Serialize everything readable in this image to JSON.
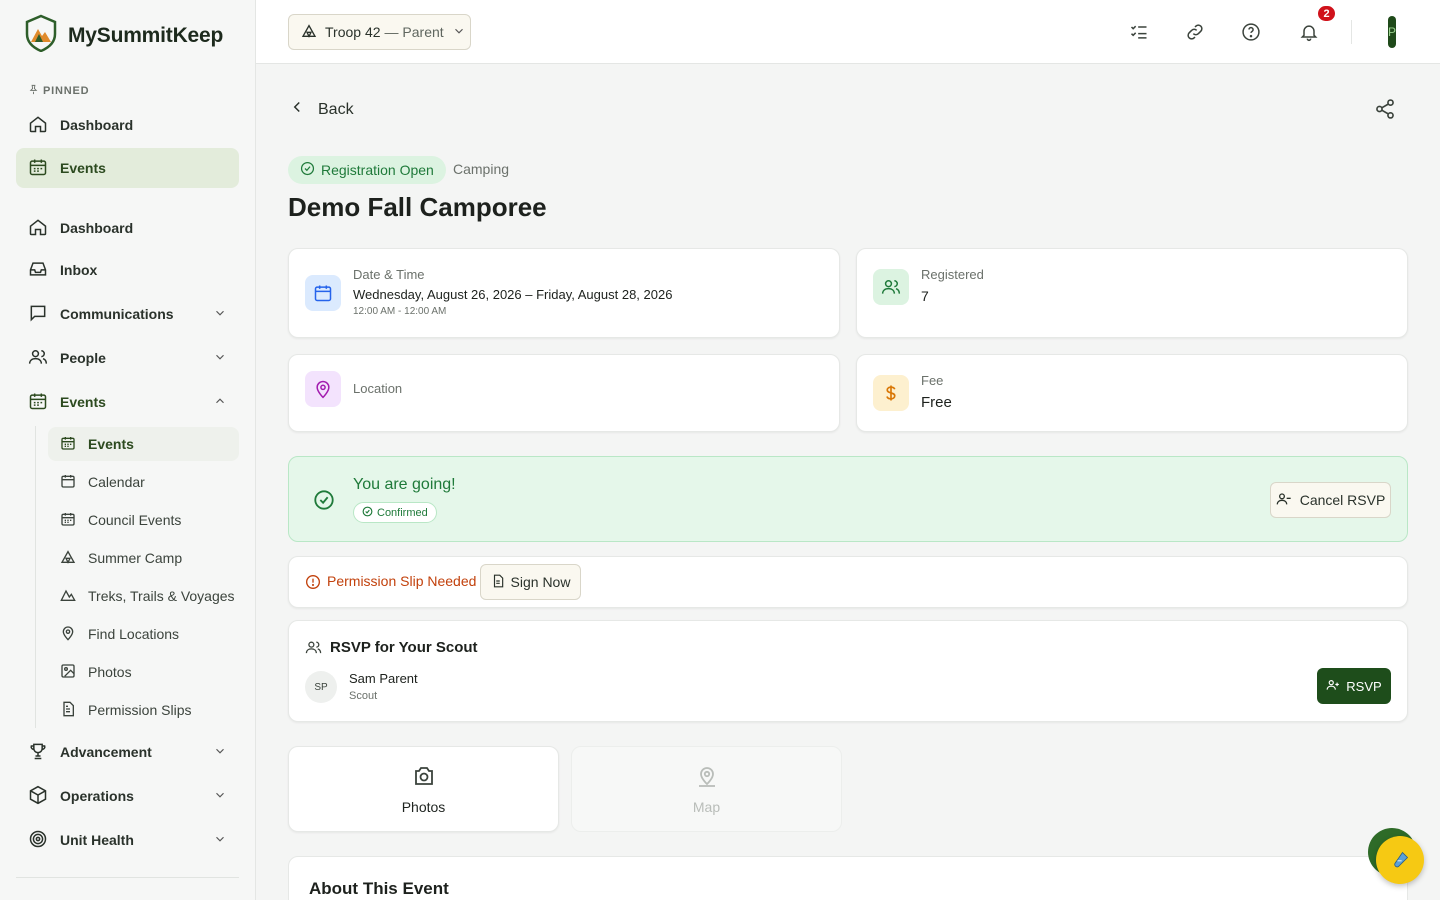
{
  "brand": {
    "name": "MySummitKeep"
  },
  "sidebar": {
    "pinned_label": "PINNED",
    "pinned": [
      {
        "label": "Dashboard",
        "icon": "home-icon"
      },
      {
        "label": "Events",
        "icon": "calendar-icon"
      }
    ],
    "items": [
      {
        "label": "Dashboard",
        "icon": "home-icon"
      },
      {
        "label": "Inbox",
        "icon": "inbox-icon"
      },
      {
        "label": "Communications",
        "icon": "message-icon"
      },
      {
        "label": "People",
        "icon": "people-icon"
      },
      {
        "label": "Events",
        "icon": "calendar-icon"
      },
      {
        "label": "Advancement",
        "icon": "trophy-icon"
      },
      {
        "label": "Operations",
        "icon": "box-icon"
      },
      {
        "label": "Unit Health",
        "icon": "target-icon"
      }
    ],
    "event_subitems": [
      {
        "label": "Events",
        "icon": "calendar-icon"
      },
      {
        "label": "Calendar",
        "icon": "calendar-icon"
      },
      {
        "label": "Council Events",
        "icon": "calendar-icon"
      },
      {
        "label": "Summer Camp",
        "icon": "tent-icon"
      },
      {
        "label": "Treks, Trails & Voyages",
        "icon": "mountain-icon"
      },
      {
        "label": "Find Locations",
        "icon": "map-pin-icon"
      },
      {
        "label": "Photos",
        "icon": "image-icon"
      },
      {
        "label": "Permission Slips",
        "icon": "document-icon"
      }
    ]
  },
  "topbar": {
    "troop": "Troop 42",
    "role": "— Parent",
    "notification_count": "2",
    "avatar_initial": "P"
  },
  "main": {
    "back_label": "Back",
    "status_pill": "Registration Open",
    "event_type": "Camping",
    "title": "Demo Fall Camporee",
    "datetime": {
      "label": "Date & Time",
      "dates": "Wednesday, August 26, 2026 – Friday, August 28, 2026",
      "times": "12:00 AM - 12:00 AM"
    },
    "registered": {
      "label": "Registered",
      "value": "7"
    },
    "location": {
      "label": "Location"
    },
    "fee": {
      "label": "Fee",
      "value": "Free"
    },
    "going": {
      "title": "You are going!",
      "badge": "Confirmed",
      "cancel_label": "Cancel RSVP"
    },
    "permission": {
      "text": "Permission Slip Needed",
      "button": "Sign Now"
    },
    "rsvp": {
      "heading": "RSVP for Your Scout",
      "scout_initials": "SP",
      "scout_name": "Sam Parent",
      "scout_role": "Scout",
      "button": "RSVP"
    },
    "tiles": {
      "photos": "Photos",
      "map": "Map"
    },
    "about_title": "About This Event"
  },
  "colors": {
    "brand_green": "#1e4d1b",
    "success_green": "#1f7a3a",
    "warning_orange": "#c2410c",
    "notification_red": "#d0121b"
  }
}
